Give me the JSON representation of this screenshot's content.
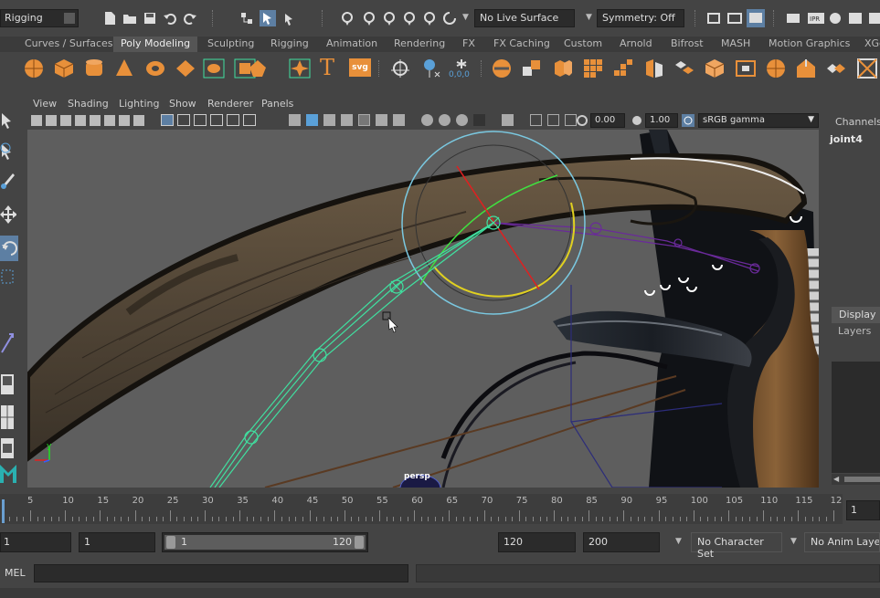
{
  "status_line": {
    "menu_set": "Rigging",
    "live_surface": "No Live Surface",
    "symmetry": "Symmetry: Off"
  },
  "shelf": {
    "tabs": [
      "Curves / Surfaces",
      "Poly Modeling",
      "Sculpting",
      "Rigging",
      "Animation",
      "Rendering",
      "FX",
      "FX Caching",
      "Custom",
      "Arnold",
      "Bifrost",
      "MASH",
      "Motion Graphics",
      "XGe"
    ],
    "active_tab": "Poly Modeling",
    "text_icon": "T",
    "svg_icon": "svg",
    "value_readout": "0,0,0"
  },
  "panel_menu": [
    "View",
    "Shading",
    "Lighting",
    "Show",
    "Renderer",
    "Panels"
  ],
  "panel_toolbar": {
    "exposure": "0.00",
    "gamma": "1.00",
    "color_space": "sRGB gamma"
  },
  "viewport": {
    "camera_label": "persp",
    "axis_y": "y"
  },
  "channel_box": {
    "title": "Channels",
    "selected": "joint4",
    "display_tab": "Display",
    "layers_tab": "Layers"
  },
  "time_slider": {
    "ticks": [
      "5",
      "10",
      "15",
      "20",
      "25",
      "30",
      "35",
      "40",
      "45",
      "50",
      "55",
      "60",
      "65",
      "70",
      "75",
      "80",
      "85",
      "90",
      "95",
      "100",
      "105",
      "110",
      "115",
      "12"
    ],
    "current_frame": "1",
    "playhead_frame": 1
  },
  "range_slider": {
    "start_frame": "1",
    "playback_start": "1",
    "range_start": "1",
    "range_end": "120",
    "playback_end": "120",
    "end_frame": "200",
    "character_set": "No Character Set",
    "anim_layer": "No Anim Layer"
  },
  "command_line": {
    "language": "MEL"
  },
  "colors": {
    "accent_orange": "#e8903a",
    "selection_blue": "#5aa0d8",
    "joint_green": "#40e0a0",
    "rotate_circle": "#7ac8e0"
  }
}
